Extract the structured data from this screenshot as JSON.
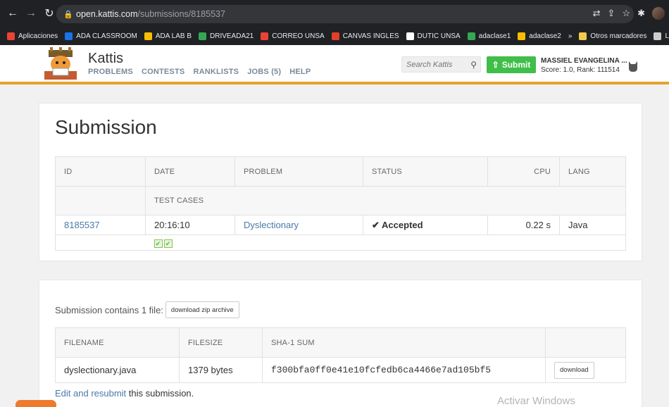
{
  "browser": {
    "url_host": "open.kattis.com",
    "url_path": "/submissions/8185537",
    "bookmarks": [
      {
        "label": "Aplicaciones",
        "color": "#ea4335"
      },
      {
        "label": "ADA CLASSROOM",
        "color": "#1a73e8"
      },
      {
        "label": "ADA LAB B",
        "color": "#fbbc04"
      },
      {
        "label": "DRIVEADA21",
        "color": "#34a853"
      },
      {
        "label": "CORREO UNSA",
        "color": "#ea4335"
      },
      {
        "label": "CANVAS INGLES",
        "color": "#e2402a"
      },
      {
        "label": "DUTIC UNSA",
        "color": "#ffffff"
      },
      {
        "label": "adaclase1",
        "color": "#34a853"
      },
      {
        "label": "adaclase2",
        "color": "#fbbc04"
      },
      {
        "label": "»",
        "color": ""
      },
      {
        "label": "Otros marcadores",
        "color": "#f2c94c"
      },
      {
        "label": "Lista de lec",
        "color": "#cccccc"
      }
    ]
  },
  "header": {
    "brand": "Kattis",
    "nav": [
      "PROBLEMS",
      "CONTESTS",
      "RANKLISTS",
      "JOBS (5)",
      "HELP"
    ],
    "search_placeholder": "Search Kattis",
    "submit_label": "Submit",
    "user_name": "MASSIEL EVANGELINA ...",
    "user_score": "Score: 1.0, Rank: 111514"
  },
  "page_title": "Submission",
  "submission_table": {
    "headers": {
      "id": "ID",
      "date": "DATE",
      "problem": "PROBLEM",
      "status": "STATUS",
      "cpu": "CPU",
      "lang": "LANG",
      "test_cases": "TEST CASES"
    },
    "row": {
      "id": "8185537",
      "date": "20:16:10",
      "problem": "Dyslectionary",
      "status": "Accepted",
      "cpu": "0.22 s",
      "lang": "Java"
    },
    "test_cases_passed": 2
  },
  "files": {
    "contains_text": "Submission contains 1 file:",
    "zip_button": "download zip archive",
    "headers": {
      "filename": "FILENAME",
      "filesize": "FILESIZE",
      "sha": "SHA-1 SUM"
    },
    "rows": [
      {
        "filename": "dyslectionary.java",
        "filesize": "1379 bytes",
        "sha": "f300bfa0ff0e41e10fcfedb6ca4466e7ad105bf5",
        "download": "download"
      }
    ],
    "edit_link": "Edit and resubmit",
    "edit_suffix": " this submission."
  },
  "watermark": "Activar Windows",
  "colors": {
    "accent": "#e4a32e",
    "submit": "#3fbe4a",
    "link": "#4a79a8"
  }
}
